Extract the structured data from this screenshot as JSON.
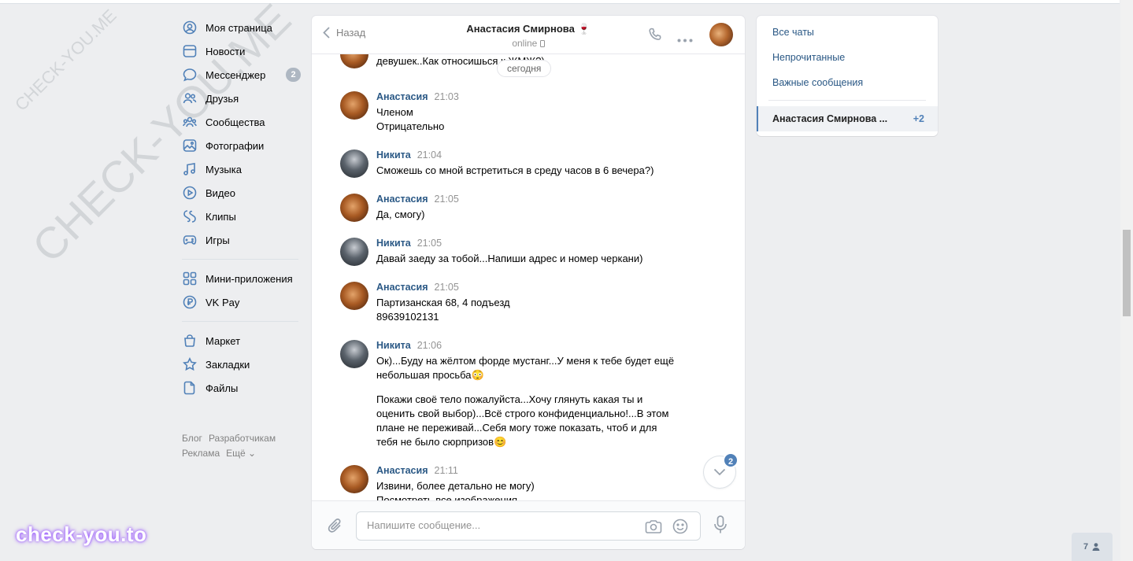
{
  "nav": {
    "items": [
      {
        "label": "Моя страница",
        "icon": "user-circle-icon"
      },
      {
        "label": "Новости",
        "icon": "news-icon"
      },
      {
        "label": "Мессенджер",
        "icon": "message-icon",
        "count": "2"
      },
      {
        "label": "Друзья",
        "icon": "friends-icon"
      },
      {
        "label": "Сообщества",
        "icon": "communities-icon"
      },
      {
        "label": "Фотографии",
        "icon": "photo-icon"
      },
      {
        "label": "Музыка",
        "icon": "music-icon"
      },
      {
        "label": "Видео",
        "icon": "video-icon"
      },
      {
        "label": "Клипы",
        "icon": "clips-icon"
      },
      {
        "label": "Игры",
        "icon": "gamepad-icon"
      }
    ],
    "items2": [
      {
        "label": "Мини-приложения",
        "icon": "apps-icon"
      },
      {
        "label": "VK Pay",
        "icon": "vkpay-icon"
      }
    ],
    "items3": [
      {
        "label": "Маркет",
        "icon": "bag-icon"
      },
      {
        "label": "Закладки",
        "icon": "star-icon"
      },
      {
        "label": "Файлы",
        "icon": "file-icon"
      }
    ],
    "footer": {
      "blog": "Блог",
      "dev": "Разработчикам",
      "ads": "Реклама",
      "more": "Ещё ⌄"
    }
  },
  "watermark": {
    "small": "CHECK-YOU.ME",
    "large": "CHECK-YOU.ME",
    "brand": "check-you.to"
  },
  "chat": {
    "back_label": "Назад",
    "peer_name": "Анастасия Смирнова 🍷",
    "peer_status": "online",
    "date_chip": "сегодня",
    "partial_message": "Рукой доводили или членом?...Люблю эмоциональных\nдевушек..Как относишься к ЖМЖ?)",
    "messages": [
      {
        "author": "Анастасия",
        "time": "21:03",
        "text": "Членом\nОтрицательно"
      },
      {
        "author": "Никита",
        "time": "21:04",
        "text": "Сможешь со мной встретиться в среду часов в 6 вечера?)"
      },
      {
        "author": "Анастасия",
        "time": "21:05",
        "text": "Да, смогу)"
      },
      {
        "author": "Никита",
        "time": "21:05",
        "text": "Давай заеду за тобой...Напиши адрес и номер черкани)"
      },
      {
        "author": "Анастасия",
        "time": "21:05",
        "text": "Партизанская 68, 4 подъезд\n89639102131"
      },
      {
        "author": "Никита",
        "time": "21:06",
        "text": "Ок)...Буду на жёлтом форде мустанг...У меня к тебе будет ещё\nнебольшая просьба😳",
        "text2": "Покажи своё тело пожалуйста...Хочу глянуть какая ты и\nоценить свой выбор)...Всё строго конфиденциально!...В этом\nплане не переживай...Себя могу тоже показать, чтоб и для\nтебя не было сюрпризов😊"
      },
      {
        "author": "Анастасия",
        "time": "21:11",
        "text": "Извини, более детально не могу)\nПосмотреть все изображения"
      }
    ],
    "unread_badge": "2",
    "input_placeholder": "Напишите сообщение..."
  },
  "right": {
    "filters": [
      "Все чаты",
      "Непрочитанные",
      "Важные сообщения"
    ],
    "active_chat": "Анастасия Смирнова ...",
    "active_count": "+2"
  },
  "online_friends": "7"
}
